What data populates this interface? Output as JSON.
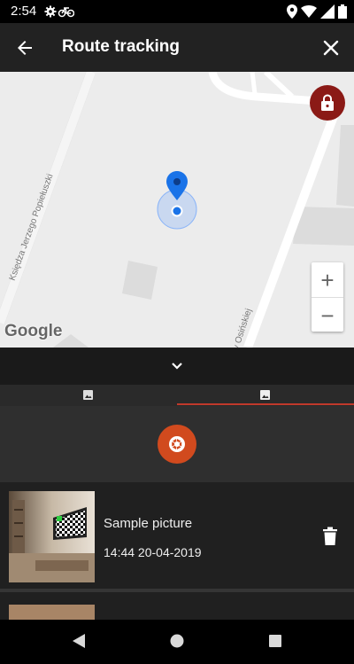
{
  "status": {
    "time": "2:54"
  },
  "appbar": {
    "title": "Route tracking"
  },
  "map": {
    "street_1": "Księdza Jerzego Popiełuszki",
    "street_2": "y Osińskiej",
    "provider": "Google"
  },
  "zoom": {
    "plus": "+",
    "minus": "−"
  },
  "photos": [
    {
      "name": "Sample picture",
      "date": "14:44 20-04-2019"
    }
  ],
  "colors": {
    "accent": "#d14a1e",
    "lock_bg": "#8b1a16",
    "tab_indicator": "#c0392b",
    "pin": "#1a73e8"
  }
}
